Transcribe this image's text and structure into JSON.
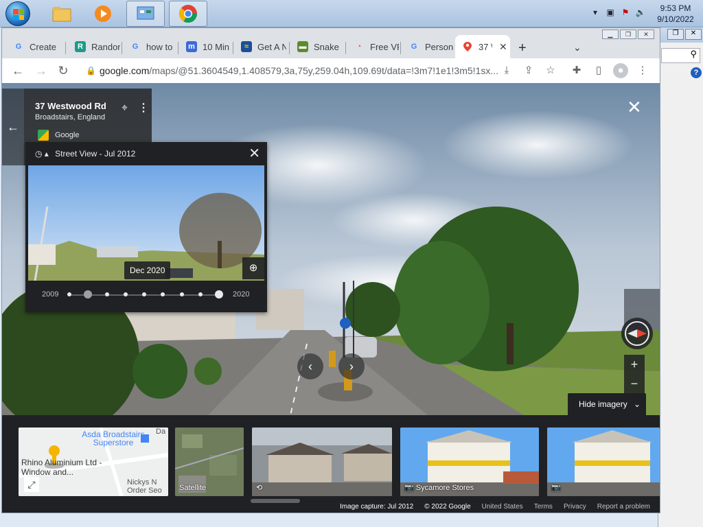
{
  "taskbar": {
    "clock_time": "9:53 PM",
    "clock_date": "9/10/2022"
  },
  "tabs": [
    {
      "title": "Create",
      "icon": "google-icon"
    },
    {
      "title": "Randor",
      "icon": "r-icon"
    },
    {
      "title": "how to",
      "icon": "google-icon"
    },
    {
      "title": "10 Min",
      "icon": "tenmin-icon"
    },
    {
      "title": "Get A N",
      "icon": "getan-icon"
    },
    {
      "title": "Snake",
      "icon": "snake-icon"
    },
    {
      "title": "Free VP",
      "icon": "vpn-icon"
    },
    {
      "title": "Persona",
      "icon": "google-icon"
    },
    {
      "title": "37 \\",
      "icon": "maps-pin-icon"
    }
  ],
  "omnibox": {
    "host": "google.com",
    "path": "/maps/@51.3604549,1.408579,3a,75y,259.04h,109.69t/data=!3m7!1e1!3m5!1sx..."
  },
  "place": {
    "title": "37 Westwood Rd",
    "subtitle": "Broadstairs, England",
    "source": "Google"
  },
  "time_machine": {
    "header": "Street View - Jul 2012",
    "selected_date": "Dec 2020",
    "start_year": "2009",
    "end_year": "2020",
    "timeline_stops": 9,
    "current_stop": 1,
    "hover_stop": 8
  },
  "controls": {
    "hide_imagery": "Hide imagery",
    "zoom_in": "+",
    "zoom_out": "−"
  },
  "filmstrip": {
    "map_labels": [
      "Asda Broadstairs Superstore",
      "Rhino Aluminium Ltd - Window and...",
      "Nickys N Order Seo",
      "Da"
    ],
    "satellite_label": "Satellite",
    "photo_label_1": "Sycamore Stores"
  },
  "footer": {
    "capture": "Image capture: Jul 2012",
    "copyright": "© 2022 Google",
    "country": "United States",
    "terms": "Terms",
    "privacy": "Privacy",
    "report": "Report a problem"
  },
  "colors": {
    "chrome_frame": "#dee1e6",
    "maps_panel": "#202124",
    "accent_blue": "#1a73e8"
  }
}
